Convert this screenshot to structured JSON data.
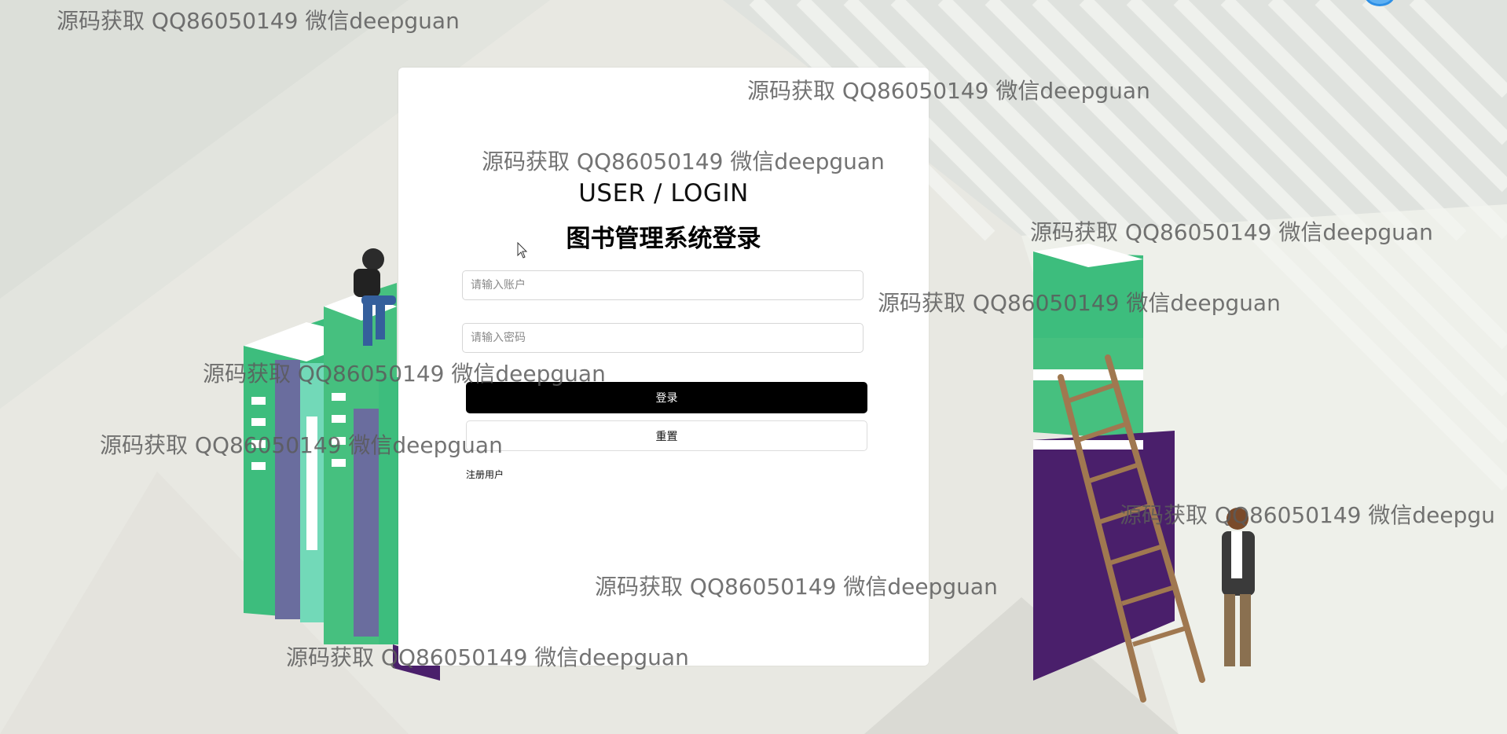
{
  "login": {
    "title_en": "USER / LOGIN",
    "title_cn": "图书管理系统登录",
    "username_placeholder": "请输入账户",
    "password_placeholder": "请输入密码",
    "login_label": "登录",
    "reset_label": "重置",
    "register_label": "注册用户"
  },
  "watermarks": [
    "源码获取 QQ86050149 微信deepguan",
    "源码获取 QQ86050149 微信deepguan",
    "源码获取 QQ86050149 微信deepguan",
    "源码获取 QQ86050149 微信deepguan",
    "源码获取 QQ86050149 微信deepguan",
    "源码获取 QQ86050149 微信deepguan",
    "源码获取 QQ86050149 微信deepguan",
    "源码获取 QQ86050149 微信deepgu",
    "源码获取 QQ86050149 微信deepguan",
    "源码获取 QQ86050149 微信deepguan"
  ],
  "colors": {
    "book_green": "#3dbd7d",
    "book_purple": "#4a1f6b",
    "book_slate": "#6a6d9e",
    "button_black": "#000000"
  }
}
